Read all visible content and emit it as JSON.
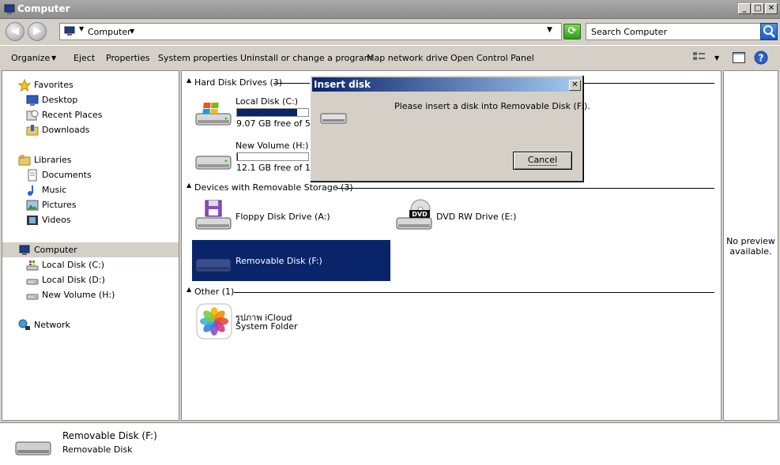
{
  "window": {
    "title": "Computer"
  },
  "address": {
    "path": "Computer",
    "search_placeholder": "Search Computer"
  },
  "toolbar": {
    "items": [
      "Organize",
      "Eject",
      "Properties",
      "System properties",
      "Uninstall or change a program",
      "Map network drive",
      "Open Control Panel"
    ]
  },
  "nav": {
    "favorites": "Favorites",
    "desktop": "Desktop",
    "recent_places": "Recent Places",
    "downloads": "Downloads",
    "libraries": "Libraries",
    "documents": "Documents",
    "music": "Music",
    "pictures": "Pictures",
    "videos": "Videos",
    "computer": "Computer",
    "local_c": "Local Disk (C:)",
    "local_d": "Local Disk (D:)",
    "new_volume_h": "New Volume (H:)",
    "network": "Network"
  },
  "content": {
    "hdd_header": "Hard Disk Drives (3)",
    "removable_header": "Devices with Removable Storage (3)",
    "other_header": "Other (1)",
    "drive_c": {
      "name": "Local Disk (C:)",
      "free": "9.07 GB free of 55.",
      "used_fraction": 0.84
    },
    "drive_h": {
      "name": "New Volume (H:)",
      "free": "12.1 GB free of 12.",
      "used_fraction": 0.01
    },
    "floppy": "Floppy Disk Drive (A:)",
    "dvd": "DVD RW Drive (E:)",
    "dvd_badge": "DVD",
    "removable": "Removable Disk (F:)",
    "icloud_name": "รูปภาพ iCloud",
    "icloud_type": "System Folder"
  },
  "preview": {
    "text_line1": "No preview",
    "text_line2": "available."
  },
  "details": {
    "name": "Removable Disk (F:)",
    "type": "Removable Disk"
  },
  "dialog": {
    "title": "Insert disk",
    "message": "Please insert a disk into Removable Disk (F:).",
    "cancel": "Cancel"
  }
}
